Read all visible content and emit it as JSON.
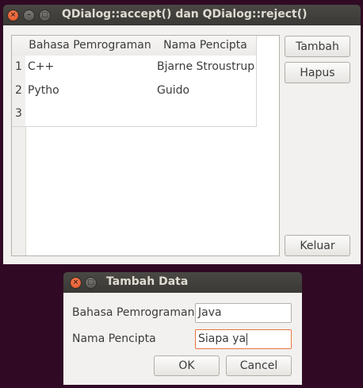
{
  "main_window": {
    "title": "QDialog::accept() dan QDialog::reject()",
    "table": {
      "headers": [
        "Bahasa Pemrograman",
        "Nama Pencipta"
      ],
      "rows": [
        {
          "num": "1",
          "bahasa": "C++",
          "pencipta": "Bjarne Stroustrup"
        },
        {
          "num": "2",
          "bahasa": "Pytho",
          "pencipta": "Guido"
        },
        {
          "num": "3",
          "bahasa": "",
          "pencipta": ""
        }
      ]
    },
    "buttons": {
      "tambah": "Tambah",
      "hapus": "Hapus",
      "keluar": "Keluar"
    }
  },
  "dialog": {
    "title": "Tambah Data",
    "bahasa_label": "Bahasa Pemrograman",
    "bahasa_value": "Java",
    "pencipta_label": "Nama Pencipta",
    "pencipta_value": "Siapa ya",
    "ok_label": "OK",
    "cancel_label": "Cancel"
  },
  "colors": {
    "desktop": "#300a24",
    "focus_border": "#e9743e",
    "close_button": "#df4a16"
  },
  "icons": {
    "close": "close-icon",
    "minimize": "minimize-icon",
    "maximize": "maximize-icon"
  }
}
